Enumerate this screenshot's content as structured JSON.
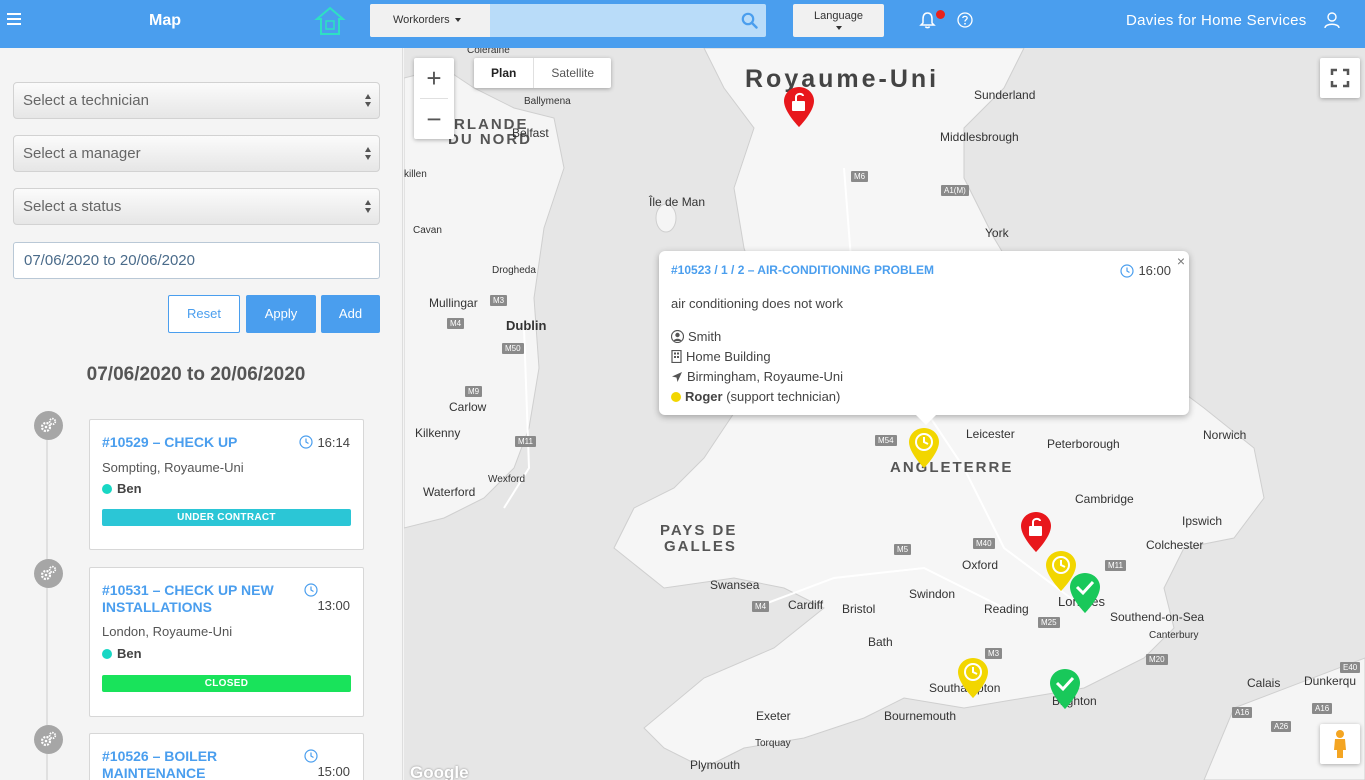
{
  "topbar": {
    "title": "Map",
    "search_dropdown": "Workorders",
    "search_placeholder": "",
    "language_label": "Language",
    "user_name": "Davies for Home Services",
    "accent": "#4a9eee"
  },
  "filters": {
    "technician_placeholder": "Select a technician",
    "manager_placeholder": "Select a manager",
    "status_placeholder": "Select a status",
    "date_range": "07/06/2020 to 20/06/2020",
    "reset_label": "Reset",
    "apply_label": "Apply",
    "add_label": "Add"
  },
  "range_title": "07/06/2020 to 20/06/2020",
  "workorders": [
    {
      "title": "#10529 – CHECK UP",
      "time": "16:14",
      "location": "Sompting, Royaume-Uni",
      "technician": "Ben",
      "tech_color": "#18d7c4",
      "status": "UNDER CONTRACT",
      "status_color": "#2bc6d6"
    },
    {
      "title": "#10531 – CHECK UP NEW INSTALLATIONS",
      "time": "13:00",
      "location": "London, Royaume-Uni",
      "technician": "Ben",
      "tech_color": "#18d7c4",
      "status": "CLOSED",
      "status_color": "#19e35b"
    },
    {
      "title": "#10526 – BOILER MAINTENANCE",
      "time": "15:00"
    }
  ],
  "map": {
    "plan_label": "Plan",
    "satellite_label": "Satellite",
    "zoom_in": "+",
    "zoom_out": "−",
    "google": "Google",
    "labels": {
      "royaume_uni": "Royaume-Uni",
      "irlande_1": "RLANDE",
      "irlande_2": "DU NORD",
      "angleterre": "ANGLETERRE",
      "pays_1": "PAYS DE",
      "pays_2": "GALLES",
      "coleraine": "Coleraine",
      "ballymena": "Ballymena",
      "belfast": "Belfast",
      "killen": "killen",
      "ile_de_man": "Île de Man",
      "cavan": "Cavan",
      "drogheda": "Drogheda",
      "mullingar": "Mullingar",
      "dublin": "Dublin",
      "carlow": "Carlow",
      "kilkenny": "Kilkenny",
      "waterford": "Waterford",
      "wexford": "Wexford",
      "sunderland": "Sunderland",
      "middlesbrough": "Middlesbrough",
      "york": "York",
      "leicester": "Leicester",
      "peterborough": "Peterborough",
      "norwich": "Norwich",
      "cambridge": "Cambridge",
      "ipswich": "Ipswich",
      "colchester": "Colchester",
      "oxford": "Oxford",
      "londres": "Londres",
      "southend": "Southend-on-Sea",
      "canterbury": "Canterbury",
      "swansea": "Swansea",
      "cardiff": "Cardiff",
      "bristol": "Bristol",
      "swindon": "Swindon",
      "reading": "Reading",
      "bath": "Bath",
      "calais": "Calais",
      "dunkerque": "Dunkerqu",
      "southampton": "Southampton",
      "brighton": "Brighton",
      "exeter": "Exeter",
      "bournemouth": "Bournemouth",
      "torquay": "Torquay",
      "plymouth": "Plymouth"
    },
    "roads": {
      "m6": "M6",
      "a1m": "A1(M)",
      "m3_ie": "M3",
      "m4_ie": "M4",
      "m50": "M50",
      "m9": "M9",
      "m11_ie": "M11",
      "m54": "M54",
      "m5": "M5",
      "m40": "M40",
      "m11": "M11",
      "m25": "M25",
      "m20": "M20",
      "m3": "M3",
      "m4": "M4",
      "a16a": "A16",
      "a16b": "A16",
      "e40": "E40",
      "a26": "A26"
    }
  },
  "popup": {
    "title": "#10523 / 1 / 2 – AIR-CONDITIONING PROBLEM",
    "time": "16:00",
    "description": "air conditioning does not work",
    "client": "Smith",
    "building": "Home Building",
    "location": "Birmingham, Royaume-Uni",
    "technician": "Roger",
    "technician_role": "(support technician)",
    "tech_color": "#f2d600",
    "close": "×"
  }
}
